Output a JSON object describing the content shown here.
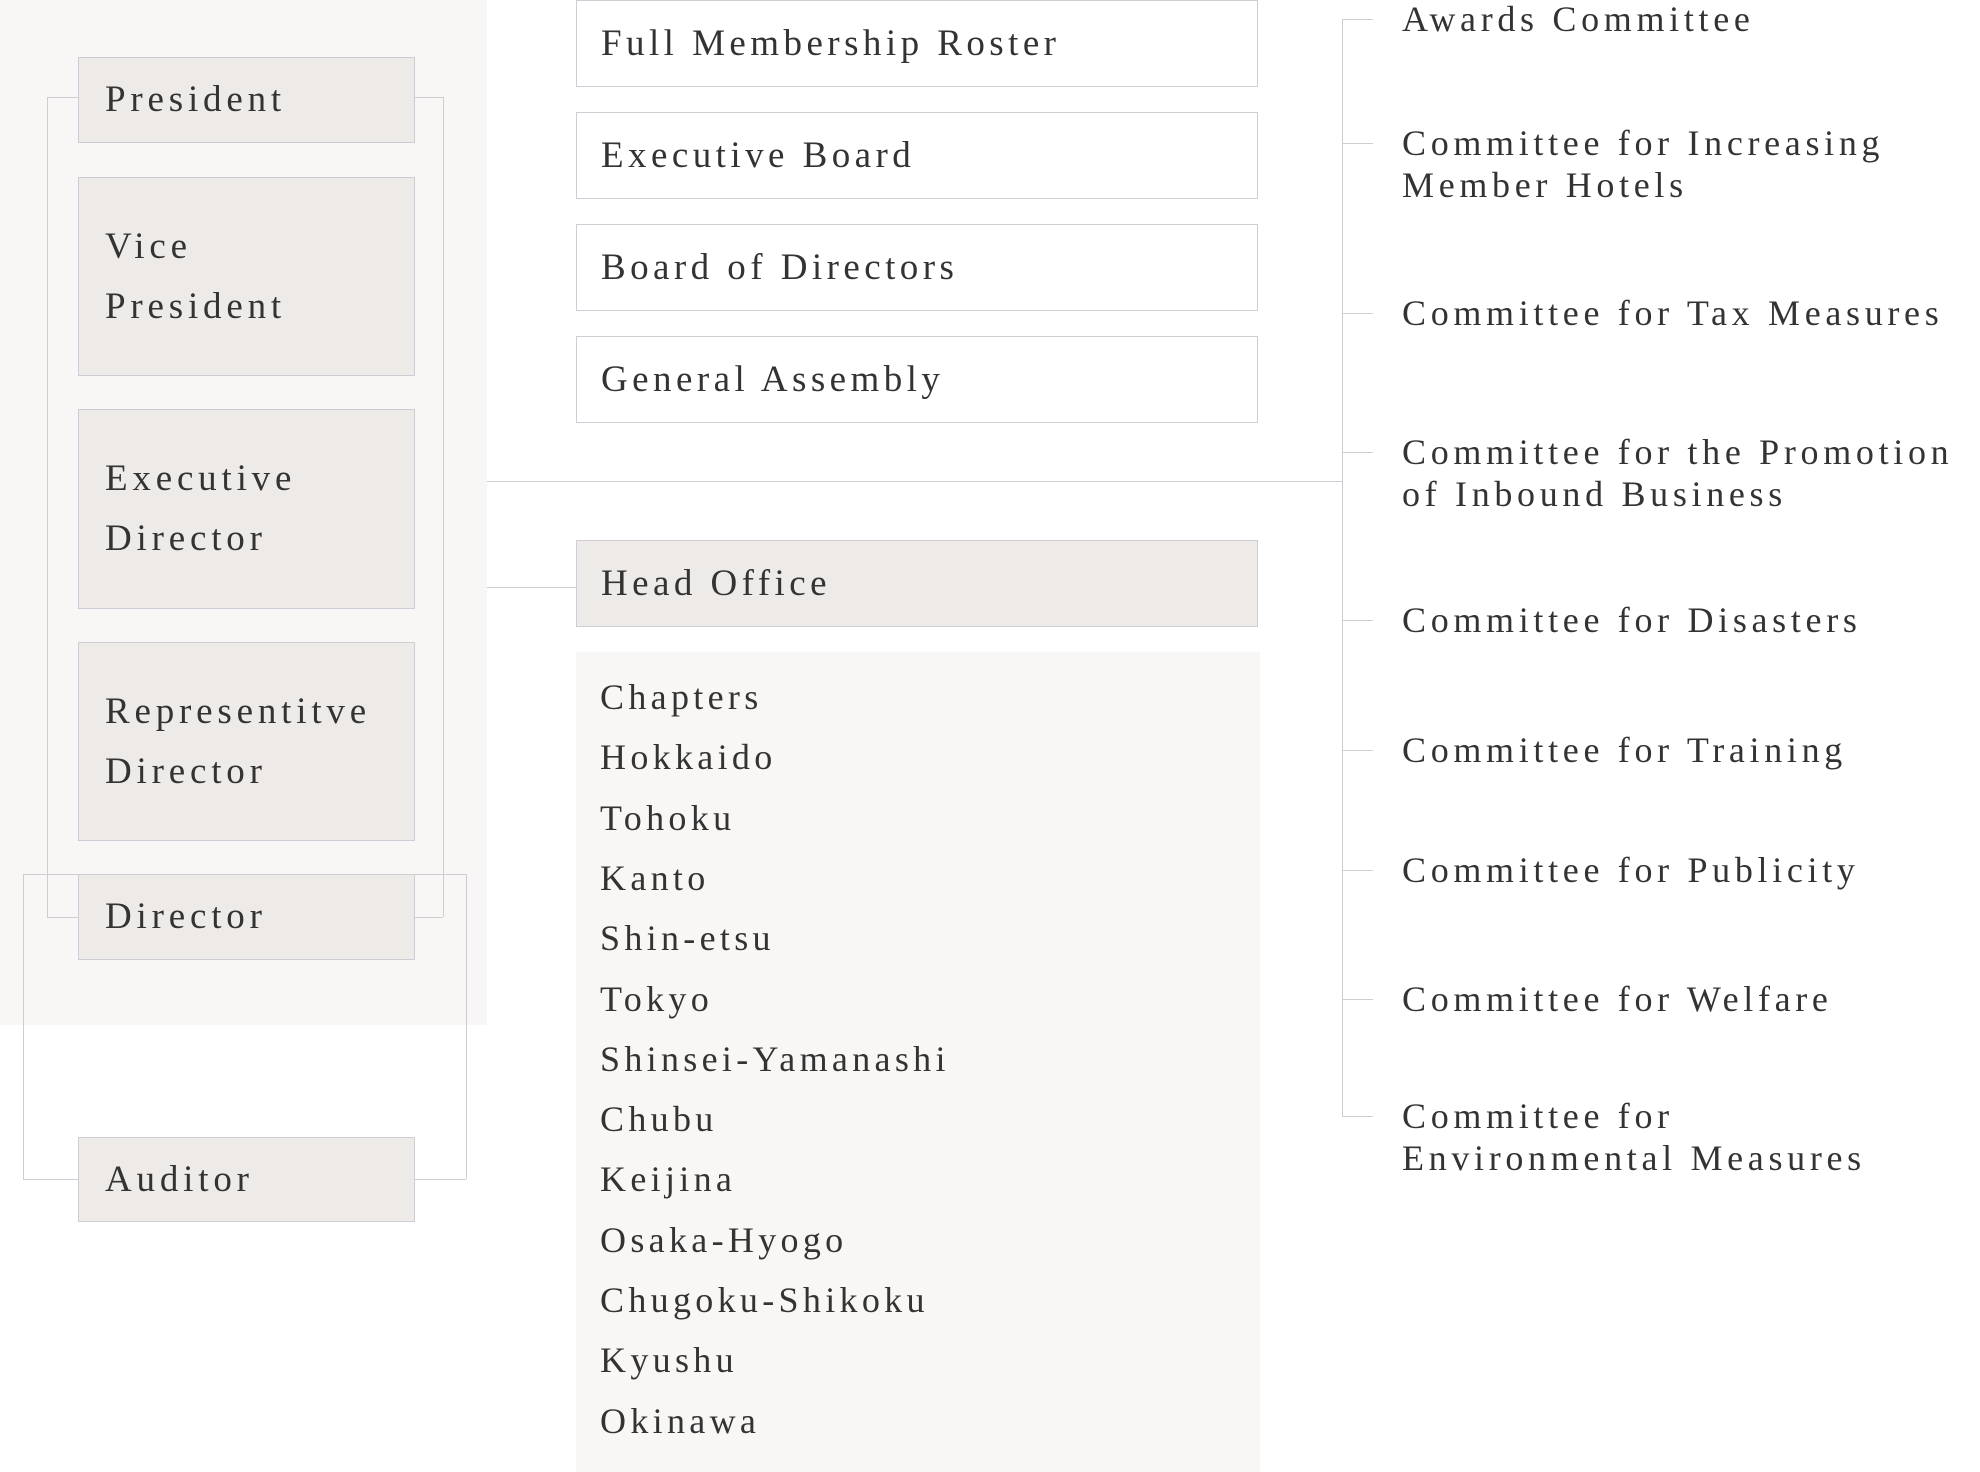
{
  "officers": {
    "president": "President",
    "vice_president": "Vice\nPresident",
    "executive_director": "Executive\nDirector",
    "representative_director": "Representitve\nDirector",
    "director": "Director",
    "auditor": "Auditor"
  },
  "bodies": {
    "full_membership_roster": "Full Membership Roster",
    "executive_board": "Executive Board",
    "board_of_directors": "Board of Directors",
    "general_assembly": "General Assembly",
    "head_office": "Head Office"
  },
  "chapters": [
    "Chapters",
    "Hokkaido",
    "Tohoku",
    "Kanto",
    "Shin-etsu",
    "Tokyo",
    "Shinsei-Yamanashi",
    "Chubu",
    "Keijina",
    "Osaka-Hyogo",
    "Chugoku-Shikoku",
    "Kyushu",
    "Okinawa"
  ],
  "committees": [
    "Awards Committee",
    "Committee for Increasing\nMember Hotels",
    "Committee for Tax Measures",
    "Committee for the Promotion\nof Inbound Business",
    "Committee for Disasters",
    "Committee for Training",
    "Committee for Publicity",
    "Committee for Welfare",
    "Committee for\nEnvironmental Measures"
  ],
  "colors": {
    "panel": "#f8f7f5",
    "box": "#eeeae7",
    "line": "#cfcdd4",
    "text": "#333333"
  }
}
